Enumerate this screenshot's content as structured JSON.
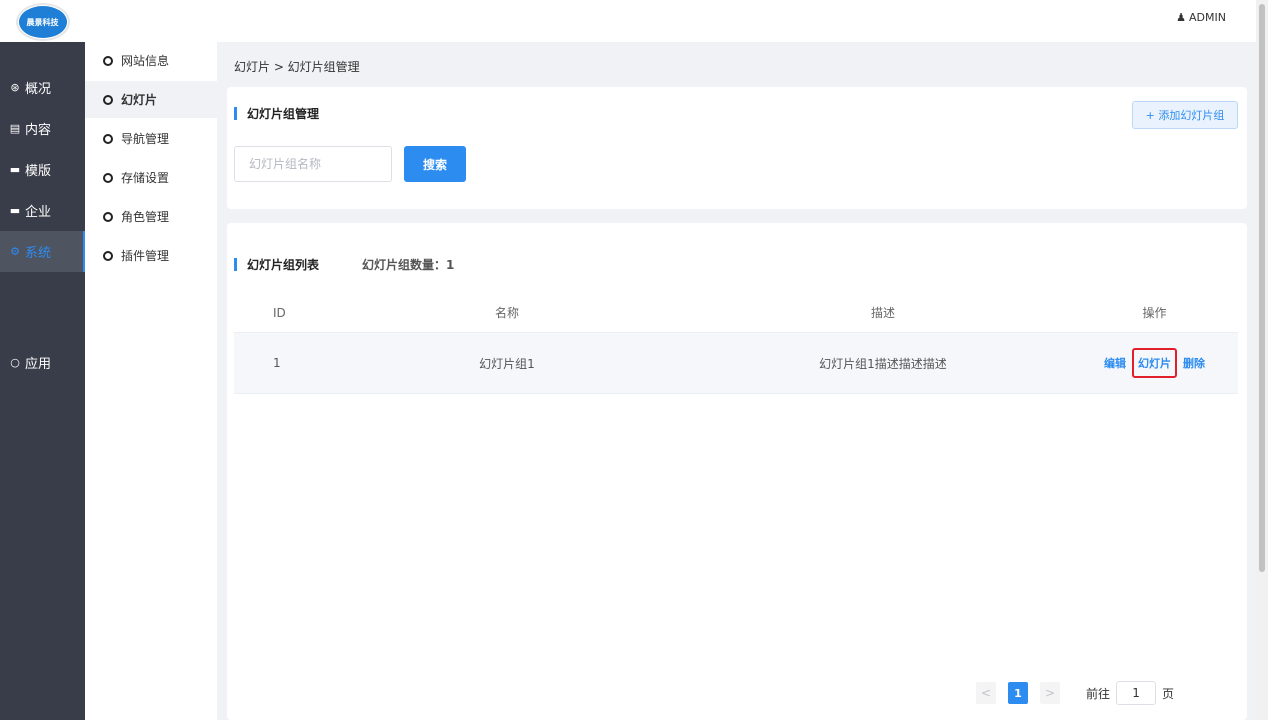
{
  "logo": {
    "text": "晨景科技"
  },
  "header": {
    "user_label": "ADMIN",
    "user_icon": "user-icon"
  },
  "sidebar": {
    "items": [
      {
        "label": "概况",
        "icon": "dashboard-icon",
        "glyph": "⊛"
      },
      {
        "label": "内容",
        "icon": "document-icon",
        "glyph": "▤"
      },
      {
        "label": "模版",
        "icon": "archive-icon",
        "glyph": "▬"
      },
      {
        "label": "企业",
        "icon": "archive-icon",
        "glyph": "▬"
      },
      {
        "label": "系统",
        "icon": "gears-icon",
        "glyph": "⚙"
      }
    ],
    "app": {
      "label": "应用",
      "icon": "circle-icon",
      "glyph": "○"
    }
  },
  "submenu": {
    "items": [
      {
        "label": "网站信息"
      },
      {
        "label": "幻灯片"
      },
      {
        "label": "导航管理"
      },
      {
        "label": "存储设置"
      },
      {
        "label": "角色管理"
      },
      {
        "label": "插件管理"
      }
    ]
  },
  "breadcrumb": "幻灯片 > 幻灯片组管理",
  "manage_card": {
    "title": "幻灯片组管理",
    "add_button": "+ 添加幻灯片组",
    "search_placeholder": "幻灯片组名称",
    "search_button": "搜索"
  },
  "list_card": {
    "title": "幻灯片组列表",
    "count_text": "幻灯片组数量：1",
    "columns": {
      "id": "ID",
      "name": "名称",
      "desc": "描述",
      "ops": "操作"
    },
    "rows": [
      {
        "id": "1",
        "name": "幻灯片组1",
        "desc": "幻灯片组1描述描述描述",
        "edit": "编辑",
        "slides": "幻灯片",
        "delete": "删除"
      }
    ]
  },
  "pagination": {
    "prev": "<",
    "current": "1",
    "next": ">",
    "goto_label": "前往",
    "goto_value": "1",
    "page_suffix": "页"
  },
  "colors": {
    "accent": "#2d8cf0",
    "sidebar_bg": "#393d49",
    "highlight_box": "#e0202a"
  }
}
